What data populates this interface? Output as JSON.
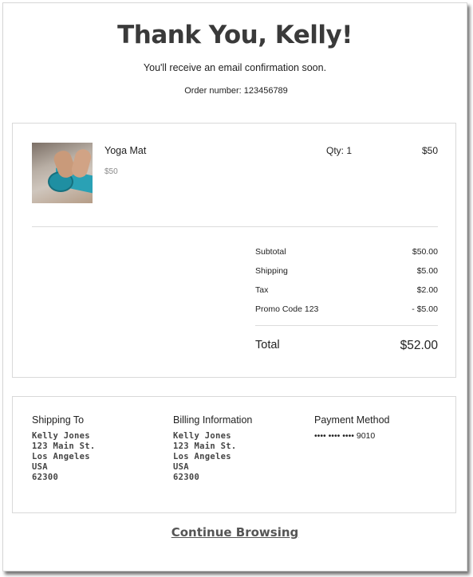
{
  "header": {
    "title": "Thank You, Kelly!",
    "subtitle": "You'll receive an email confirmation soon.",
    "order_label": "Order number:",
    "order_number": "123456789"
  },
  "item": {
    "name": "Yoga Mat",
    "unit_price": "$50",
    "qty": "Qty: 1",
    "line_total": "$50",
    "image": "yoga-mat-photo"
  },
  "summary": {
    "rows": [
      {
        "label": "Subtotal",
        "value": "$50.00"
      },
      {
        "label": "Shipping",
        "value": "$5.00"
      },
      {
        "label": "Tax",
        "value": "$2.00"
      },
      {
        "label": "Promo Code 123",
        "value": "- $5.00"
      }
    ],
    "total_label": "Total",
    "total_value": "$52.00"
  },
  "shipping": {
    "heading": "Shipping To",
    "lines": [
      "Kelly Jones",
      "123 Main St.",
      "Los Angeles",
      "USA",
      "62300"
    ]
  },
  "billing": {
    "heading": "Billing Information",
    "lines": [
      "Kelly Jones",
      "123 Main St.",
      "Los Angeles",
      "USA",
      "62300"
    ]
  },
  "payment": {
    "heading": "Payment Method",
    "card_mask": "•••• •••• ••••",
    "card_last4": "9010"
  },
  "continue_label": "Continue Browsing"
}
